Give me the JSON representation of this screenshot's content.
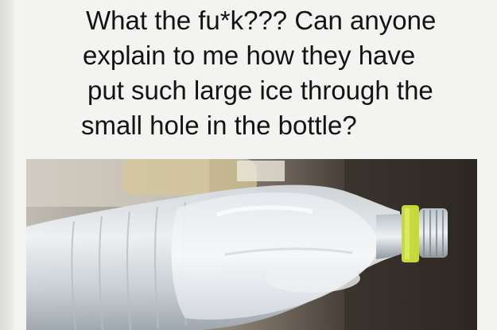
{
  "post": {
    "caption_lines": [
      "What the fu*k???  Can anyone",
      "explain to me how they have",
      "put such large ice through the",
      "small hole in the bottle?"
    ]
  },
  "photo": {
    "subject": "water-bottle-with-ice",
    "colors": {
      "cap_ring": "#c6d93a",
      "ice": "#e9ecef",
      "background": "#3b3531"
    }
  }
}
